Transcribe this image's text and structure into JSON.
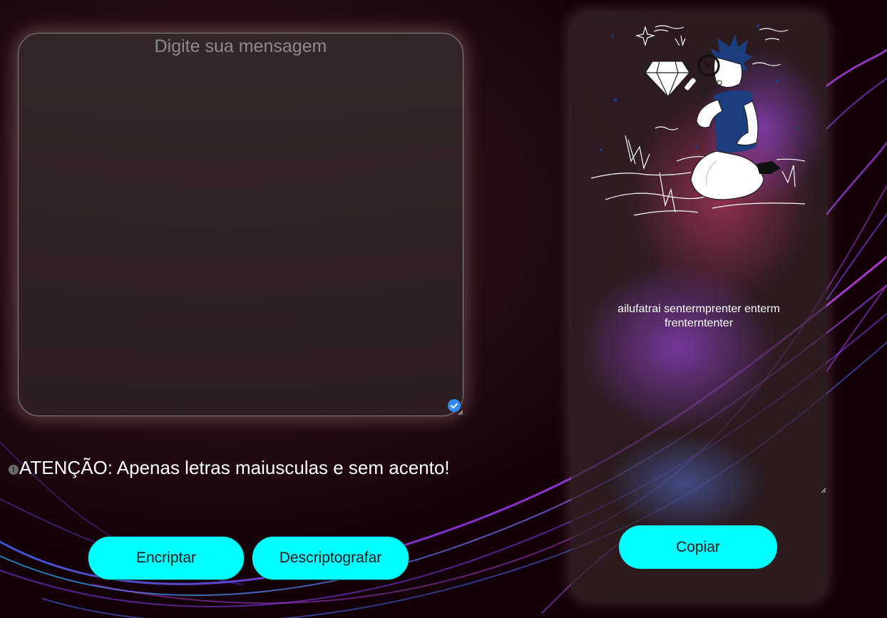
{
  "input": {
    "placeholder": "Digite sua mensagem"
  },
  "warning": {
    "text": "ATENÇÃO: Apenas letras maiusculas e sem acento!"
  },
  "buttons": {
    "encrypt": "Encriptar",
    "decrypt": "Descriptografar",
    "copy": "Copiar"
  },
  "result": {
    "text": "ailufatrai sentermprenter enterm frenterntenter"
  },
  "icons": {
    "info": "info-circle-icon",
    "check": "check-circle-icon",
    "resize": "resize-handle-icon"
  },
  "colors": {
    "accent": "#00ffff",
    "background": "#150008",
    "check": "#2f8cf0",
    "figure_blue": "#1a3a6e"
  }
}
